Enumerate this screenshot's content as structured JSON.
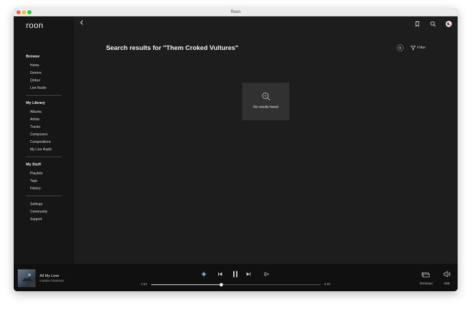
{
  "window": {
    "title": "Roon"
  },
  "sidebar": {
    "logo": "roon",
    "sections": [
      {
        "title": "Browse",
        "items": [
          "Home",
          "Genres",
          "Qobuz",
          "Live Radio"
        ]
      },
      {
        "title": "My Library",
        "items": [
          "Albums",
          "Artists",
          "Tracks",
          "Composers",
          "Compositions",
          "My Live Radio"
        ]
      },
      {
        "title": "My Stuff",
        "items": [
          "Playlists",
          "Tags",
          "History"
        ]
      },
      {
        "title": "",
        "items": [
          "Settings",
          "Community",
          "Support"
        ]
      }
    ]
  },
  "header": {
    "icons": [
      "back-chevron-icon",
      "bookmark-icon",
      "search-icon",
      "profile-avatar"
    ]
  },
  "main": {
    "title": "Search results for \"Them Croked Vultures\"",
    "filter_label": "Filter",
    "empty_state": {
      "icon": "search-icon",
      "message": "No results found"
    }
  },
  "player": {
    "track_title": "All My Love",
    "artist": "London Grammar",
    "elapsed": "1:53",
    "duration": "4:33",
    "progress": 0.414,
    "zone": "Tambaqui",
    "volume": "-6dB"
  },
  "colors": {
    "window_bg": "#1b1b1b",
    "sidebar_bg": "#161616",
    "player_bg": "#101010",
    "empty_box_bg": "#313131"
  }
}
